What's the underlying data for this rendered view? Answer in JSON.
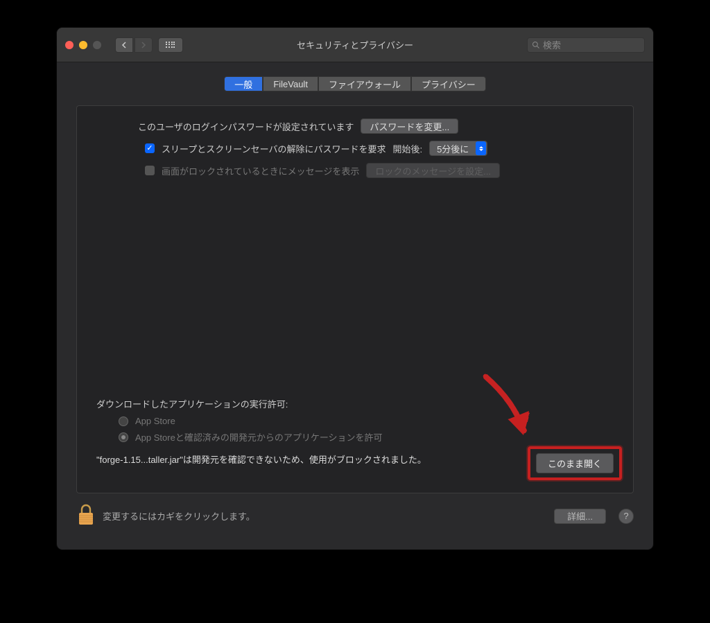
{
  "window": {
    "title": "セキュリティとプライバシー",
    "search_placeholder": "検索"
  },
  "tabs": [
    {
      "label": "一般"
    },
    {
      "label": "FileVault"
    },
    {
      "label": "ファイアウォール"
    },
    {
      "label": "プライバシー"
    }
  ],
  "general": {
    "login_pw_set": "このユーザのログインパスワードが設定されています",
    "change_password": "パスワードを変更...",
    "require_pw_label": "スリープとスクリーンセーバの解除にパスワードを要求",
    "after_label": "開始後:",
    "after_value": "5分後に",
    "lock_message_label": "画面がロックされているときにメッセージを表示",
    "set_lock_message": "ロックのメッセージを設定..."
  },
  "downloads": {
    "header": "ダウンロードしたアプリケーションの実行許可:",
    "option_appstore": "App Store",
    "option_identified": "App Storeと確認済みの開発元からのアプリケーションを許可",
    "blocked_text": "\"forge-1.15...taller.jar\"は開発元を確認できないため、使用がブロックされました。",
    "open_anyway": "このまま開く"
  },
  "footer": {
    "lock_text": "変更するにはカギをクリックします。",
    "details": "詳細...",
    "help": "?"
  }
}
